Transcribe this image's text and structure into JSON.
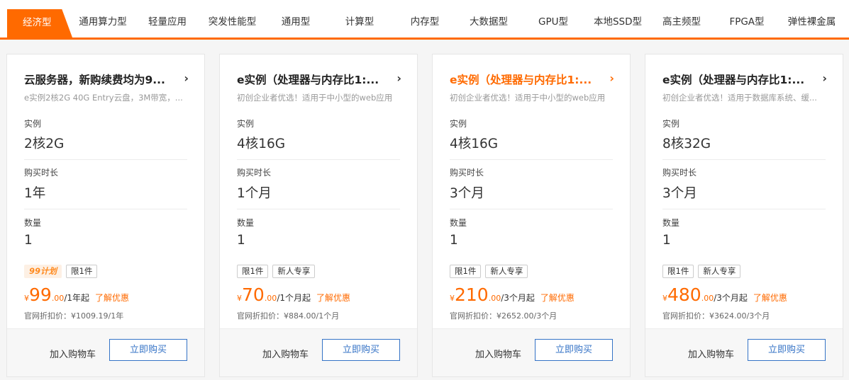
{
  "tabs": [
    {
      "label": "经济型",
      "active": true
    },
    {
      "label": "通用算力型"
    },
    {
      "label": "轻量应用"
    },
    {
      "label": "突发性能型"
    },
    {
      "label": "通用型"
    },
    {
      "label": "计算型"
    },
    {
      "label": "内存型"
    },
    {
      "label": "大数据型"
    },
    {
      "label": "GPU型"
    },
    {
      "label": "本地SSD型"
    },
    {
      "label": "高主频型"
    },
    {
      "label": "FPGA型"
    },
    {
      "label": "弹性裸金属"
    }
  ],
  "field_labels": {
    "instance": "实例",
    "duration": "购买时长",
    "quantity": "数量"
  },
  "cards": [
    {
      "title": "云服务器，新购续费均为9...",
      "desc": "e实例2核2G 40G Entry云盘，3M带宽，...",
      "instance": "2核2G",
      "duration": "1年",
      "quantity": "1",
      "tags": [
        "99计划",
        "限1件"
      ],
      "currency": "¥",
      "price_int": "99",
      "price_dec": ".00",
      "price_unit": "/1年起",
      "learn_more": "了解优惠",
      "original_price": "官网折扣价：¥1009.19/1年",
      "add_to_cart": "加入购物车",
      "buy_now": "立即购买"
    },
    {
      "title": "e实例（处理器与内存比1:...",
      "desc": "初创企业者优选！适用于中小型的web应用",
      "instance": "4核16G",
      "duration": "1个月",
      "quantity": "1",
      "tags": [
        "限1件",
        "新人专享"
      ],
      "currency": "¥",
      "price_int": "70",
      "price_dec": ".00",
      "price_unit": "/1个月起",
      "learn_more": "了解优惠",
      "original_price": "官网折扣价：¥884.00/1个月",
      "add_to_cart": "加入购物车",
      "buy_now": "立即购买"
    },
    {
      "title": "e实例（处理器与内存比1:...",
      "desc": "初创企业者优选！适用于中小型的web应用",
      "instance": "4核16G",
      "duration": "3个月",
      "quantity": "1",
      "tags": [
        "限1件",
        "新人专享"
      ],
      "currency": "¥",
      "price_int": "210",
      "price_dec": ".00",
      "price_unit": "/3个月起",
      "learn_more": "了解优惠",
      "original_price": "官网折扣价：¥2652.00/3个月",
      "add_to_cart": "加入购物车",
      "buy_now": "立即购买"
    },
    {
      "title": "e实例（处理器与内存比1:...",
      "desc": "初创企业者优选！适用于数据库系统、缓...",
      "instance": "8核32G",
      "duration": "3个月",
      "quantity": "1",
      "tags": [
        "限1件",
        "新人专享"
      ],
      "currency": "¥",
      "price_int": "480",
      "price_dec": ".00",
      "price_unit": "/3个月起",
      "learn_more": "了解优惠",
      "original_price": "官网折扣价：¥3624.00/3个月",
      "add_to_cart": "加入购物车",
      "buy_now": "立即购买"
    }
  ],
  "colors": {
    "accent": "#ff6a00",
    "buy_border": "#3573c6",
    "promo_bg": "#fdf0e4"
  }
}
